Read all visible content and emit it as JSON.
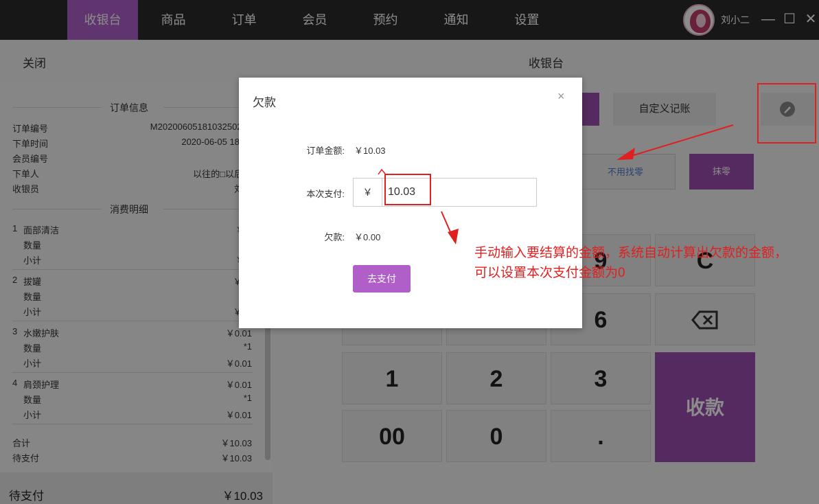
{
  "nav": {
    "items": [
      {
        "label": "收银台",
        "active": true
      },
      {
        "label": "商品"
      },
      {
        "label": "订单"
      },
      {
        "label": "会员"
      },
      {
        "label": "预约"
      },
      {
        "label": "通知"
      },
      {
        "label": "设置"
      }
    ],
    "user_name": "刘小二"
  },
  "window": {
    "minimize": "—",
    "maximize": "☐",
    "close": "✕"
  },
  "header": {
    "close_label": "关闭",
    "title": "收银台"
  },
  "order_info": {
    "section_title": "订单信息",
    "rows": [
      {
        "label": "订单编号",
        "value": "M2020060518103250242"
      },
      {
        "label": "下单时间",
        "value": "2020-06-05 18:10"
      },
      {
        "label": "会员编号",
        "value": ""
      },
      {
        "label": "下单人",
        "value": "以往的□以后的"
      },
      {
        "label": "收银员",
        "value": "刘小"
      }
    ]
  },
  "consumption": {
    "section_title": "消费明细",
    "items": [
      {
        "index": "1",
        "name": "面部清洁",
        "price": "￥0.",
        "qty_label": "数量",
        "qty": "",
        "subtotal_label": "小计",
        "subtotal": "￥0."
      },
      {
        "index": "2",
        "name": "拔罐",
        "price": "￥10",
        "qty_label": "数量",
        "qty": "",
        "subtotal_label": "小计",
        "subtotal": "￥10"
      },
      {
        "index": "3",
        "name": "水嫩护肤",
        "price": "￥0.01",
        "qty_label": "数量",
        "qty": "*1",
        "subtotal_label": "小计",
        "subtotal": "￥0.01"
      },
      {
        "index": "4",
        "name": "肩颈护理",
        "price": "￥0.01",
        "qty_label": "数量",
        "qty": "*1",
        "subtotal_label": "小计",
        "subtotal": "￥0.01"
      }
    ],
    "total_label": "合计",
    "total": "￥10.03",
    "pending_label": "待支付",
    "pending": "￥10.03"
  },
  "footer": {
    "pending_label": "待支付",
    "pending_amount": "￥10.03"
  },
  "right": {
    "custom_tab": "自定义记账",
    "no_change": "不用找零",
    "round_off": "抹零",
    "keys": [
      "9",
      "C",
      "6",
      "⌫",
      "1",
      "2",
      "3",
      "收款",
      "00",
      "0",
      "."
    ]
  },
  "modal": {
    "title": "欠款",
    "close": "×",
    "order_amount_label": "订单金额:",
    "order_amount": "￥10.03",
    "pay_label": "本次支付:",
    "currency": "￥",
    "pay_value": "10.03",
    "debt_label": "欠款:",
    "debt": "￥0.00",
    "submit": "去支付"
  },
  "annotation": {
    "text": "手动输入要结算的金额，系统自动计算出欠款的金额，可以设置本次支付金额为0"
  },
  "colors": {
    "brand": "#b05fc8",
    "topbar": "#2b2b2b",
    "annotation": "#e02020"
  }
}
